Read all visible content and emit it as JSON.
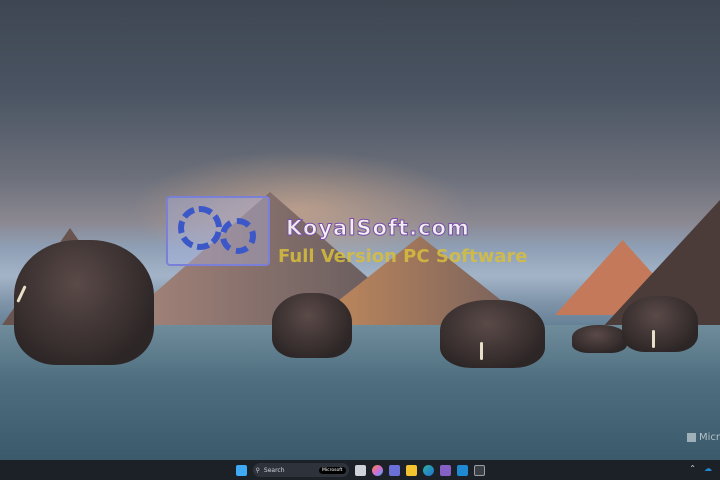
{
  "watermark": {
    "title": "KoyalSoft.com",
    "subtitle": "Full Version PC Software"
  },
  "desktop": {
    "brand_mark": "Micr"
  },
  "taskbar": {
    "search_placeholder": "Search",
    "search_badge": "Microsoft",
    "apps": [
      {
        "name": "start-icon",
        "color": "#3fa9f5"
      },
      {
        "name": "task-view-icon",
        "color": "#cfd3d8"
      },
      {
        "name": "copilot-icon",
        "color": "#d86bd0"
      },
      {
        "name": "teams-icon",
        "color": "#6b6fd8"
      },
      {
        "name": "file-explorer-icon",
        "color": "#f4c430"
      },
      {
        "name": "edge-icon",
        "color": "#2fb3a0"
      },
      {
        "name": "visual-studio-icon",
        "color": "#8661c5"
      },
      {
        "name": "vscode-icon",
        "color": "#1f8ad2"
      },
      {
        "name": "terminal-icon",
        "color": "#9aa0a6"
      }
    ]
  }
}
